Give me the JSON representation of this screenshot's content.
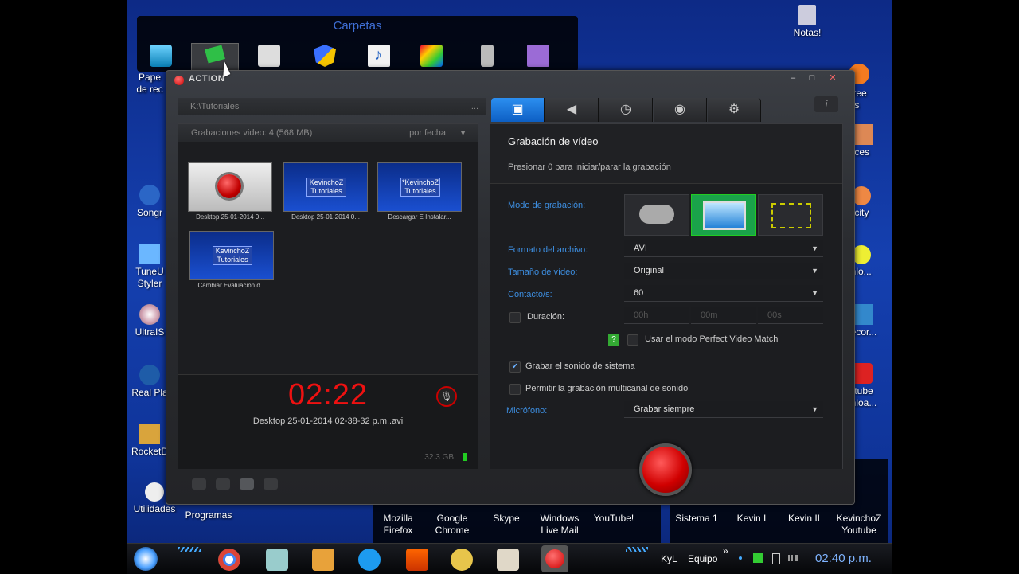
{
  "desktop": {
    "folder_popup_title": "Carpetas",
    "right_icons": [
      {
        "name": "notes",
        "label": "Notas!"
      },
      {
        "name": "avast",
        "label": "st! Free\ntivirus"
      },
      {
        "name": "ences",
        "label": "ences"
      },
      {
        "name": "audacity",
        "label": "dacity"
      },
      {
        "name": "download",
        "label": "wnlo..."
      },
      {
        "name": "recorder",
        "label": "Recor..."
      },
      {
        "name": "youtube-dl",
        "label": "outube\nwnloa..."
      }
    ],
    "left_icons": [
      {
        "name": "papelera",
        "label": "Pape\nde rec"
      },
      {
        "name": "songr",
        "label": "Songr"
      },
      {
        "name": "tuneup",
        "label": "TuneU\nStyler"
      },
      {
        "name": "ultraiso",
        "label": "UltraIS"
      },
      {
        "name": "realplayer",
        "label": "Real Pla"
      },
      {
        "name": "rocketdock",
        "label": "RocketD"
      },
      {
        "name": "utilidades",
        "label": "Utilidades"
      },
      {
        "name": "programas",
        "label": "Programas"
      }
    ],
    "dock_apps": [
      {
        "name": "firefox",
        "label": "Mozilla\nFirefox"
      },
      {
        "name": "chrome",
        "label": "Google\nChrome"
      },
      {
        "name": "skype",
        "label": "Skype"
      },
      {
        "name": "live-mail",
        "label": "Windows\nLive Mail"
      },
      {
        "name": "youtube",
        "label": "YouTube!"
      }
    ],
    "dock_systems": [
      {
        "name": "sistema-1",
        "label": "Sistema 1"
      },
      {
        "name": "kevin-i",
        "label": "Kevin I"
      },
      {
        "name": "kevin-ii",
        "label": "Kevin II"
      },
      {
        "name": "kevinchoz-youtube",
        "label": "KevinchoZ\nYoutube"
      }
    ]
  },
  "app": {
    "title": "ACTION",
    "path": "K:\\Tutoriales",
    "path_more": "...",
    "recordings_header": "Grabaciones video: 4 (568 MB)",
    "sort_label": "por fecha",
    "thumbnails": [
      {
        "caption": "Desktop 25-01-2014 0...",
        "number": "1",
        "kind": "record"
      },
      {
        "caption": "Desktop 25-01-2014 0...",
        "number": "2",
        "kind": "kevincho",
        "text": "KevinchoZ\nTutoriales"
      },
      {
        "caption": "Descargar E Instalar...",
        "number": "3",
        "kind": "kevincho",
        "text": "*KevinchoZ\nTutoriales"
      },
      {
        "caption": "Cambiar Evaluacion d...",
        "number": "4",
        "kind": "kevincho",
        "text": "KevinchoZ\nTutoriales"
      }
    ],
    "timer": "02:22",
    "current_file": "Desktop 25-01-2014 02-38-32 p.m..avi",
    "disk_free": "32.3 GB",
    "right_panel": {
      "heading": "Grabación de vídeo",
      "hint": "Presionar 0 para iniciar/parar la grabación",
      "mode_label": "Modo de grabación:",
      "format_label": "Formato del archivo:",
      "format_value": "AVI",
      "size_label": "Tamaño de vídeo:",
      "size_value": "Original",
      "fps_label": "Contacto/s:",
      "fps_value": "60",
      "duration_label": "Duración:",
      "dur_h": "00h",
      "dur_m": "00m",
      "dur_s": "00s",
      "help_glyph": "?",
      "perfect_match_label": "Usar el modo Perfect Video Match",
      "system_sound_label": "Grabar el sonido de sistema",
      "system_sound_checked": true,
      "multichannel_label": "Permitir la grabación multicanal de sonido",
      "mic_label": "Micrófono:",
      "mic_value": "Grabar siempre"
    }
  },
  "taskbar": {
    "lang": "KyL",
    "equipo": "Equipo",
    "more": "»",
    "clock": "02:40 p.m."
  }
}
